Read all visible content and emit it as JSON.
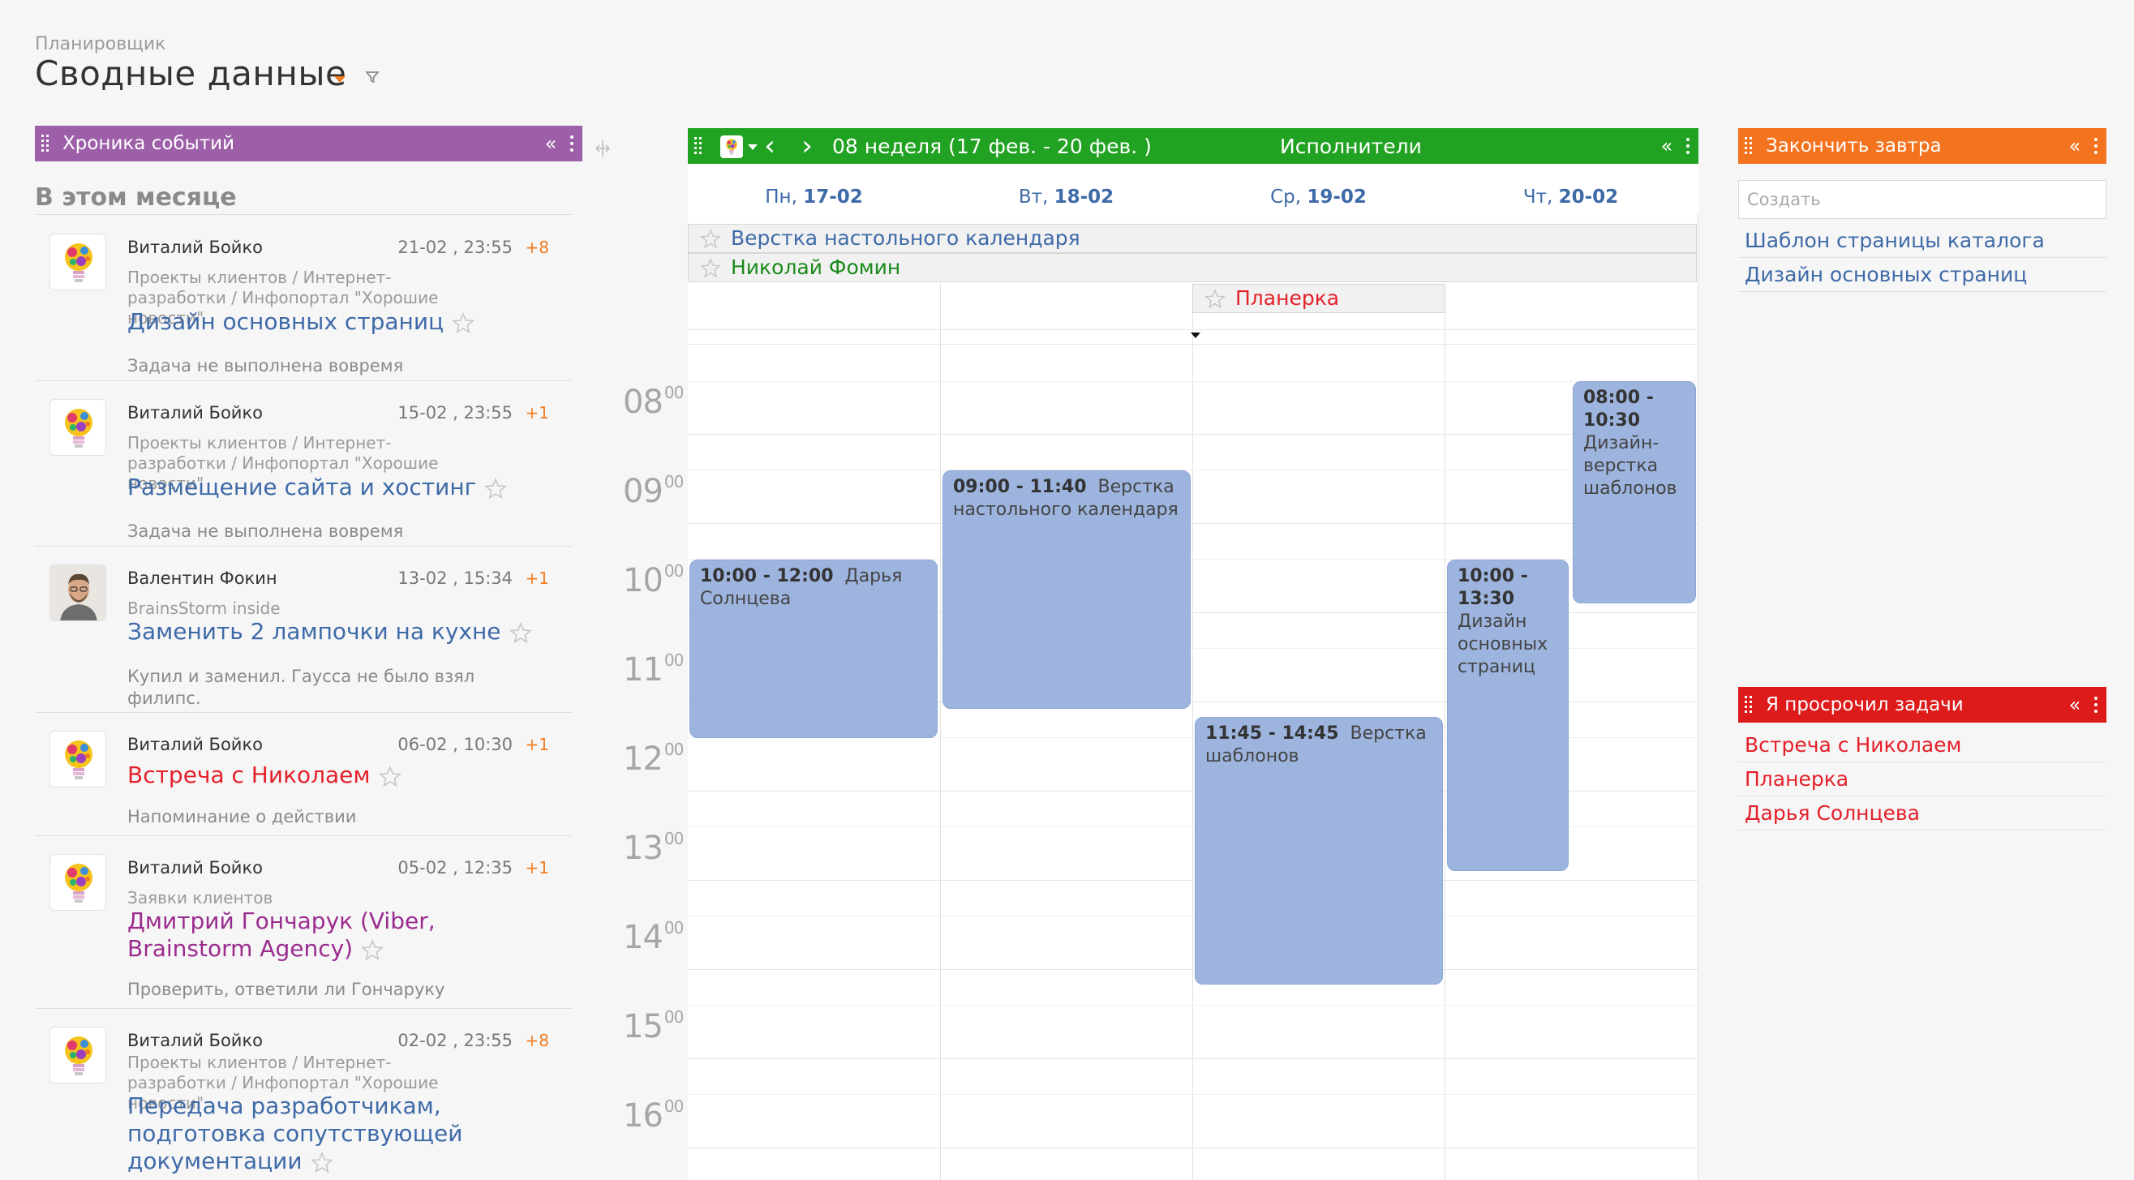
{
  "header": {
    "breadcrumb": "Планировщик",
    "title": "Сводные данные"
  },
  "feed": {
    "title": "Хроника событий",
    "collapse": "«",
    "section": "В этом месяце",
    "items": [
      {
        "author": "Виталий Бойко",
        "date": "21-02 , 23:55",
        "count": "+8",
        "project": "Проекты клиентов / Интернет-разработки / Инфопортал \"Хорошие новости\"",
        "task": "Дизайн основных страниц",
        "task_color": "#3e6aa8",
        "note": "Задача не выполнена вовремя",
        "avatar": "lightbulb-avatar"
      },
      {
        "author": "Виталий Бойко",
        "date": "15-02 , 23:55",
        "count": "+1",
        "project": "Проекты клиентов / Интернет-разработки / Инфопортал \"Хорошие новости\"",
        "task": "Размещение сайта и хостинг",
        "task_color": "#3e6aa8",
        "note": "Задача не выполнена вовремя",
        "avatar": "lightbulb-avatar"
      },
      {
        "author": "Валентин Фокин",
        "date": "13-02 , 15:34",
        "count": "+1",
        "project": "BrainsStorm inside",
        "task": "Заменить 2 лампочки на кухне",
        "task_color": "#3e6aa8",
        "note": "Купил и заменил. Гаусса не было взял филипс.",
        "avatar": "person-photo-avatar"
      },
      {
        "author": "Виталий Бойко",
        "date": "06-02 , 10:30",
        "count": "+1",
        "project": "",
        "task": "Встреча с Николаем",
        "task_color": "#e4202a",
        "note": "Напоминание о действии",
        "avatar": "lightbulb-avatar"
      },
      {
        "author": "Виталий Бойко",
        "date": "05-02 , 12:35",
        "count": "+1",
        "project": "Заявки клиентов",
        "task": "Дмитрий Гончарук (Viber, Brainstorm Agency)",
        "task_color": "#9b2c8f",
        "note": "Проверить, ответили ли Гончаруку",
        "avatar": "lightbulb-avatar"
      },
      {
        "author": "Виталий Бойко",
        "date": "02-02 , 23:55",
        "count": "+8",
        "project": "Проекты клиентов / Интернет-разработки / Инфопортал \"Хорошие новости\"",
        "task": "Передача разработчикам, подготовка сопутствующей документации",
        "task_color": "#3e6aa8",
        "note": "",
        "avatar": "lightbulb-avatar"
      }
    ]
  },
  "calendar": {
    "week": "08 неделя  (17 фев. - 20 фев. )",
    "executors": "Исполнители",
    "collapse": "«",
    "days": [
      {
        "dow": "Пн,",
        "date": "17-02"
      },
      {
        "dow": "Вт,",
        "date": "18-02"
      },
      {
        "dow": "Ср,",
        "date": "19-02"
      },
      {
        "dow": "Чт,",
        "date": "20-02"
      }
    ],
    "allday": [
      {
        "title": "Верстка настольного календаря",
        "color": "#3e6aa8"
      },
      {
        "title": "Николай Фомин",
        "color": "#1a8a1a"
      }
    ],
    "allday_day3": {
      "title": "Планерка",
      "color": "#e4202a"
    },
    "hours": [
      "08",
      "09",
      "10",
      "11",
      "12",
      "13",
      "14",
      "15",
      "16"
    ],
    "hour_minutes": "00",
    "events": [
      {
        "time": "10:00 - 12:00",
        "title": "Дарья Солнцева",
        "day": 0
      },
      {
        "time": "09:00 - 11:40",
        "title": "Верстка настольного календаря",
        "day": 1
      },
      {
        "time": "11:45 - 14:45",
        "title": "Верстка шаблонов",
        "day": 2
      },
      {
        "time": "10:00 - 13:30",
        "title": "Дизайн основных страниц",
        "day": 3
      },
      {
        "time": "08:00 - 10:30",
        "title": "Дизайн-верстка шаблонов",
        "day": 3
      }
    ]
  },
  "tomorrow": {
    "title": "Закончить завтра",
    "collapse": "«",
    "placeholder": "Создать",
    "items": [
      "Шаблон страницы каталога",
      "Дизайн основных страниц"
    ],
    "item_color": "#3e6aa8"
  },
  "overdue": {
    "title": "Я просрочил задачи",
    "collapse": "«",
    "items": [
      "Встреча с Николаем",
      "Планерка",
      "Дарья Солнцева"
    ],
    "item_color": "#e4202a"
  }
}
